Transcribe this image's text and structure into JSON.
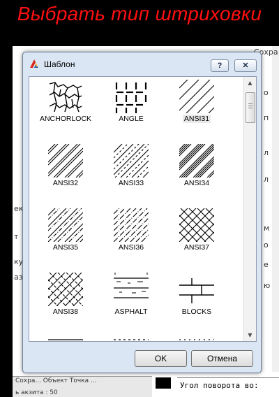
{
  "caption": "Выбрать тип штриховки",
  "dialog": {
    "title": "Шаблон",
    "help_label": "?",
    "close_label": "✕",
    "ok_label": "OK",
    "cancel_label": "Отмена"
  },
  "patterns": [
    {
      "name": "ANCHORLOCK"
    },
    {
      "name": "ANGLE"
    },
    {
      "name": "ANSI31",
      "selected": true
    },
    {
      "name": "ANSI32"
    },
    {
      "name": "ANSI33"
    },
    {
      "name": "ANSI34"
    },
    {
      "name": "ANSI35"
    },
    {
      "name": "ANSI36"
    },
    {
      "name": "ANSI37"
    },
    {
      "name": "ANSI38"
    },
    {
      "name": "ASPHALT"
    },
    {
      "name": "BLOCKS"
    }
  ],
  "background": {
    "right_labels": [
      "Сохра",
      "о",
      "п",
      "л",
      "л",
      "м",
      "о",
      "е",
      "ю"
    ],
    "left_labels": [
      "ек",
      "т",
      "ку",
      "аз"
    ],
    "bottom_left": "Сохра... Объект Точка ...",
    "bottom_small": "ь акзита : 50",
    "command_text": "Угол поворота во:"
  },
  "colors": {
    "caption": "#ff1010",
    "dialog_frame": "#dbe6f4"
  }
}
